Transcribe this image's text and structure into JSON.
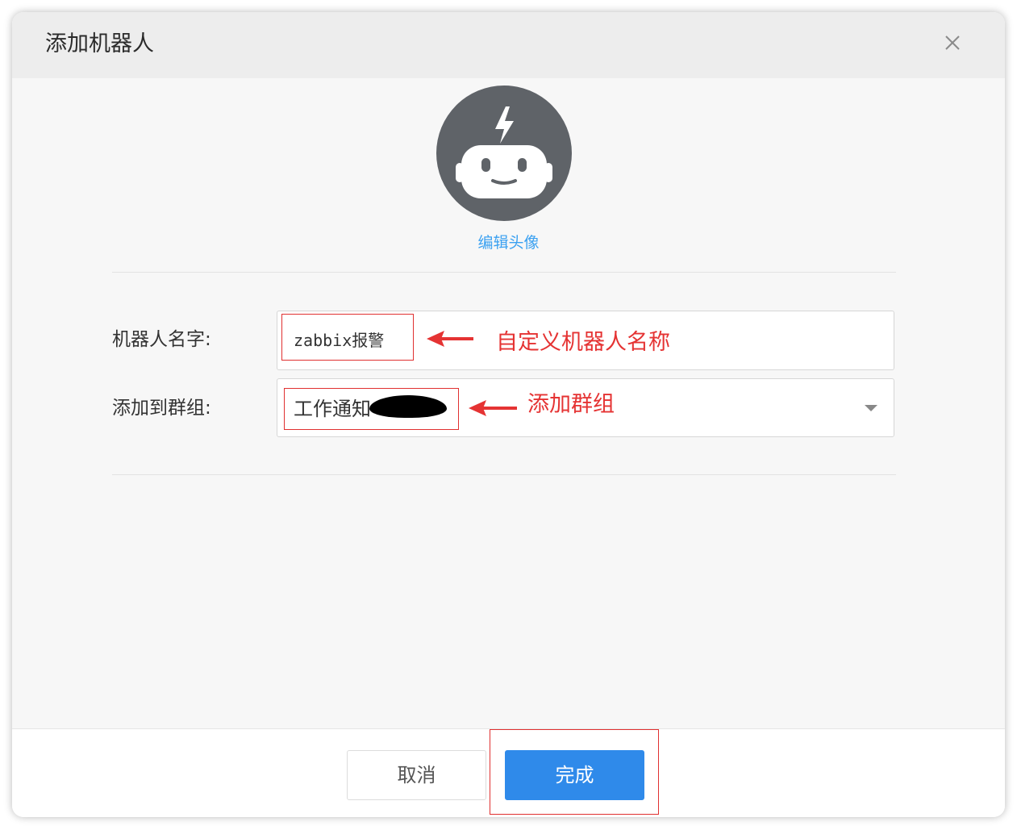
{
  "dialog": {
    "title": "添加机器人",
    "close_icon": "close-icon"
  },
  "avatar": {
    "icon": "robot-icon",
    "edit_label": "编辑头像"
  },
  "form": {
    "name_label": "机器人名字:",
    "name_value": "zabbix报警",
    "group_label": "添加到群组:",
    "group_value": "工作通知",
    "group_dropdown_icon": "caret-down-icon"
  },
  "annotations": {
    "name_note": "自定义机器人名称",
    "group_note": "添加群组",
    "color": "#e53333"
  },
  "footer": {
    "cancel_label": "取消",
    "done_label": "完成"
  },
  "colors": {
    "accent": "#2f8aea",
    "link": "#3ba1f1",
    "avatar_bg": "#5f6368"
  }
}
